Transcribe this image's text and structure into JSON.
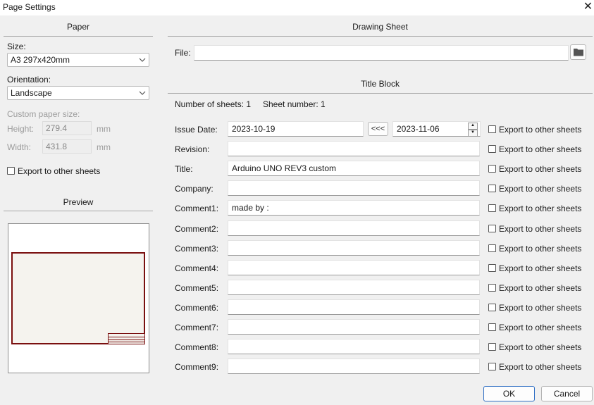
{
  "window": {
    "title": "Page Settings"
  },
  "paper": {
    "section_title": "Paper",
    "size_label": "Size:",
    "size_value": "A3 297x420mm",
    "orientation_label": "Orientation:",
    "orientation_value": "Landscape",
    "custom_size_label": "Custom paper size:",
    "height_label": "Height:",
    "height_value": "279.4",
    "width_label": "Width:",
    "width_value": "431.8",
    "unit": "mm",
    "export_label": "Export to other sheets"
  },
  "preview": {
    "section_title": "Preview"
  },
  "drawing_sheet": {
    "section_title": "Drawing Sheet",
    "file_label": "File:",
    "file_value": ""
  },
  "title_block": {
    "section_title": "Title Block",
    "num_sheets": "Number of sheets: 1",
    "sheet_number": "Sheet number: 1",
    "copy_date_button": "<<<",
    "date_picker_value": "2023-11-06",
    "export_label": "Export to other sheets",
    "fields": [
      {
        "label": "Issue Date:",
        "value": "2023-10-19"
      },
      {
        "label": "Revision:",
        "value": ""
      },
      {
        "label": "Title:",
        "value": "Arduino UNO REV3 custom"
      },
      {
        "label": "Company:",
        "value": ""
      },
      {
        "label": "Comment1:",
        "value": "made by :"
      },
      {
        "label": "Comment2:",
        "value": ""
      },
      {
        "label": "Comment3:",
        "value": ""
      },
      {
        "label": "Comment4:",
        "value": ""
      },
      {
        "label": "Comment5:",
        "value": ""
      },
      {
        "label": "Comment6:",
        "value": ""
      },
      {
        "label": "Comment7:",
        "value": ""
      },
      {
        "label": "Comment8:",
        "value": ""
      },
      {
        "label": "Comment9:",
        "value": ""
      }
    ]
  },
  "buttons": {
    "ok": "OK",
    "cancel": "Cancel"
  },
  "icons": {
    "close": "close-icon",
    "folder": "folder-icon",
    "chevron": "chevron-down-icon"
  },
  "colors": {
    "sheet_border": "#7a0f0f",
    "ok_border": "#2f6fc4"
  }
}
